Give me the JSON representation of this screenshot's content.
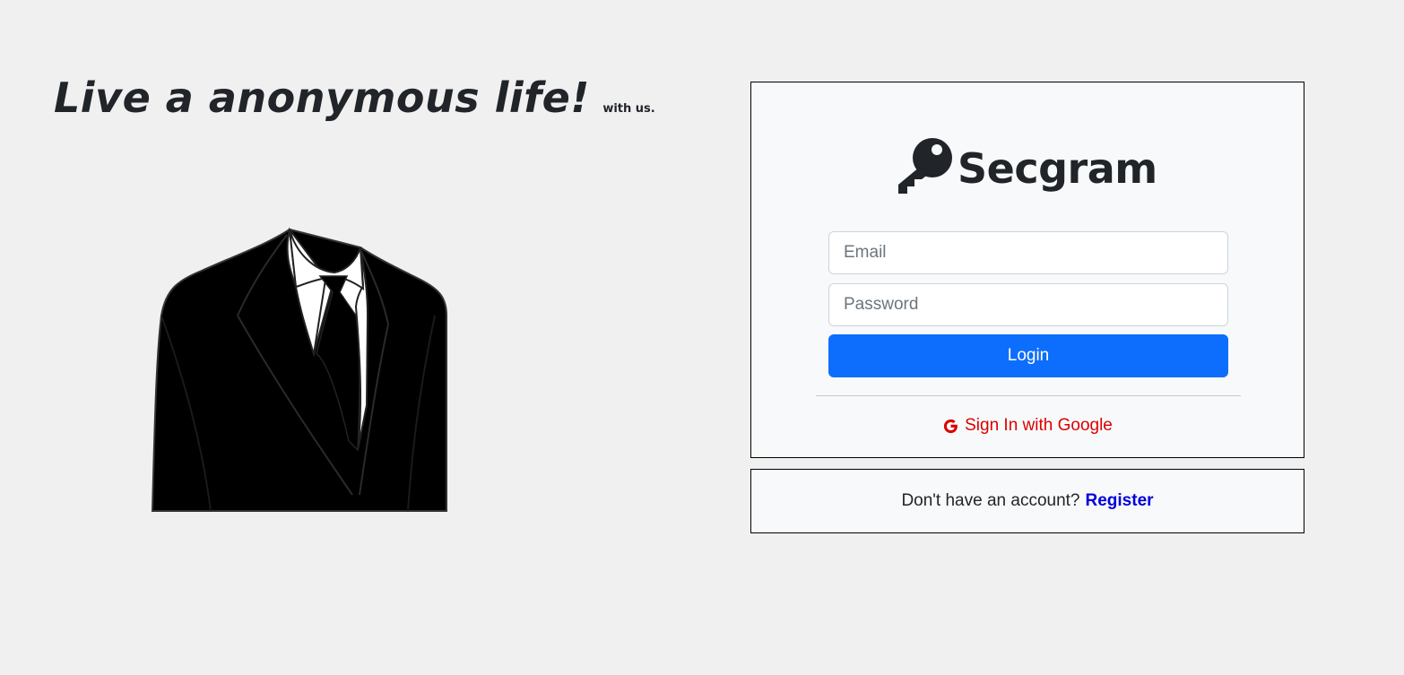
{
  "hero": {
    "title": "Live a anonymous life!",
    "subtitle": "with us."
  },
  "illustration": {
    "icon": "anonymous-suit-icon"
  },
  "login": {
    "brand_icon": "key-icon",
    "brand_name": "Secgram",
    "email_placeholder": "Email",
    "password_placeholder": "Password",
    "login_label": "Login",
    "google_icon": "google-icon",
    "google_label": "Sign In with Google"
  },
  "register": {
    "prompt": "Don't have an account?",
    "link_label": "Register"
  },
  "colors": {
    "primary": "#0d6efd",
    "google": "#dc0000",
    "register_link": "#0000dd",
    "card_bg": "#f8f9fa",
    "page_bg": "#f0f0f0"
  }
}
